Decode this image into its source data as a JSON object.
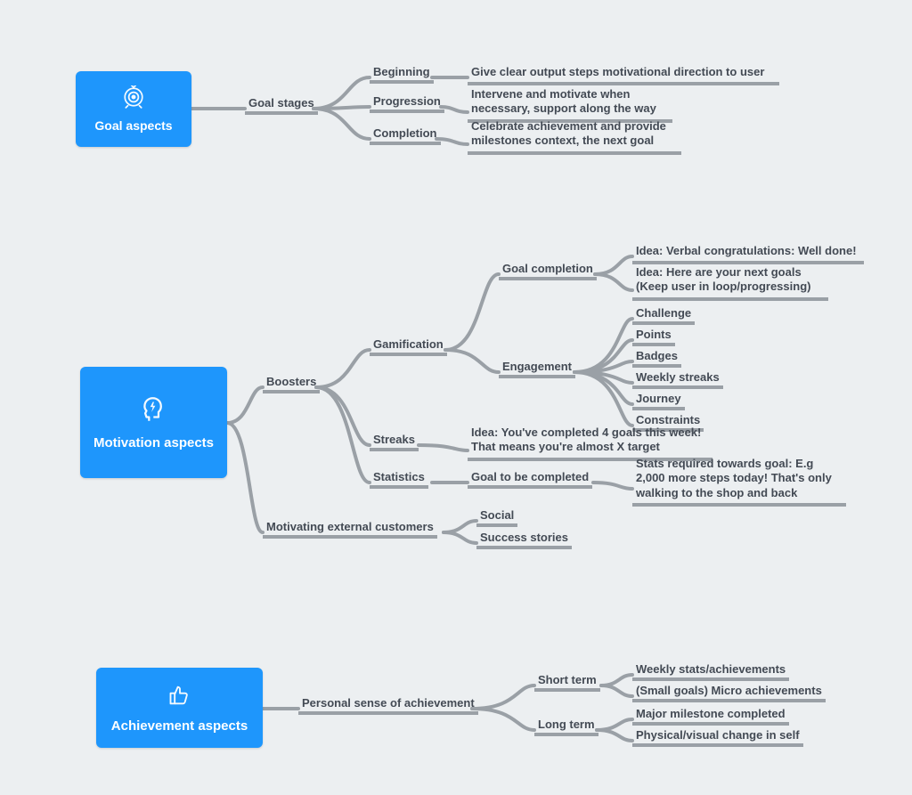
{
  "roots": {
    "goal": {
      "title": "Goal aspects"
    },
    "motivation": {
      "title": "Motivation aspects"
    },
    "achievement": {
      "title": "Achievement aspects"
    }
  },
  "goal": {
    "stages": "Goal stages",
    "beginning": "Beginning",
    "beginning_desc": "Give clear output steps motivational direction to user",
    "progression": "Progression",
    "progression_desc": "Intervene and motivate when necessary, support along the way",
    "completion": "Completion",
    "completion_desc": "Celebrate achievement and provide milestones context, the next goal"
  },
  "motivation": {
    "boosters": "Boosters",
    "gamification": "Gamification",
    "goal_completion": "Goal completion",
    "gc_idea1": "Idea: Verbal congratulations: Well done!",
    "gc_idea2": "Idea: Here are your next goals (Keep user in loop/progressing)",
    "engagement": "Engagement",
    "eng_challenge": "Challenge",
    "eng_points": "Points",
    "eng_badges": "Badges",
    "eng_weekly": "Weekly streaks",
    "eng_journey": "Journey",
    "eng_constraints": "Constraints",
    "streaks": "Streaks",
    "streaks_desc": "Idea: You've completed 4 goals this week! That means you're almost X target",
    "statistics": "Statistics",
    "stat_gtbc": "Goal to be completed",
    "stat_desc": "Stats required towards goal: E.g 2,000 more steps today! That's only walking to the shop and back",
    "mec": "Motivating external customers",
    "mec_social": "Social",
    "mec_success": "Success stories"
  },
  "achievement": {
    "psa": "Personal sense of achievement",
    "short": "Short term",
    "short_weekly": "Weekly stats/achievements",
    "short_small": "(Small goals) Micro achievements",
    "long": "Long term",
    "long_major": "Major milestone completed",
    "long_physical": "Physical/visual change in self"
  }
}
